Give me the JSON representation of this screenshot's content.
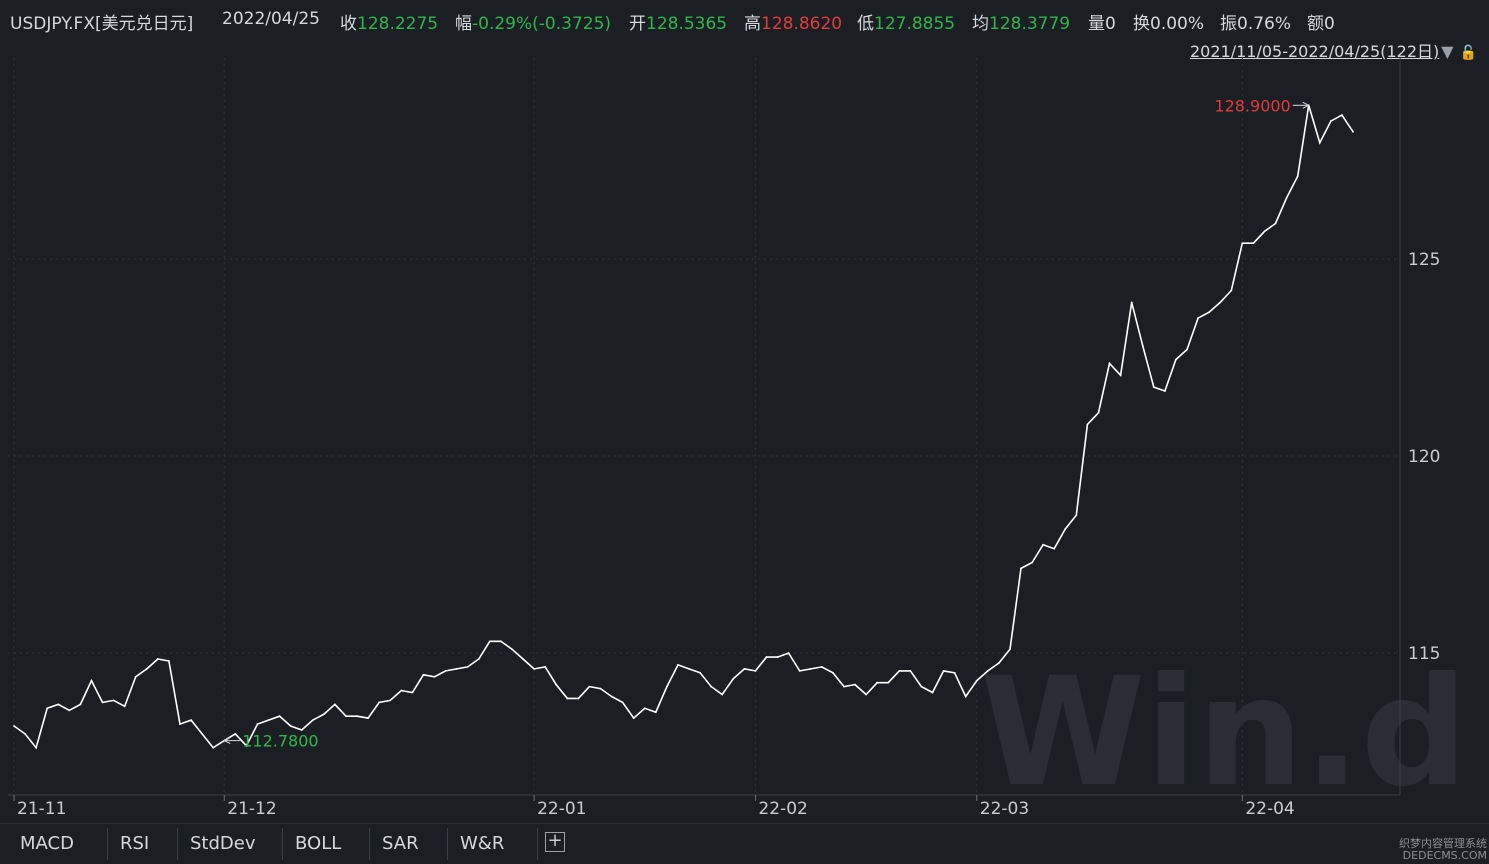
{
  "header": {
    "symbol": "USDJPY.FX[美元兑日元]",
    "date": "2022/04/25",
    "close_label": "收",
    "close_value": "128.2275",
    "change_label": "幅",
    "change_value": "-0.29%(-0.3725)",
    "open_label": "开",
    "open_value": "128.5365",
    "high_label": "高",
    "high_value": "128.8620",
    "low_label": "低",
    "low_value": "127.8855",
    "avg_label": "均",
    "avg_value": "128.3779",
    "volume_label": "量",
    "volume_value": "0",
    "turnover_label": "换",
    "turnover_value": "0.00%",
    "amplitude_label": "振",
    "amplitude_value": "0.76%",
    "amount_label": "额",
    "amount_value": "0"
  },
  "range_selector": {
    "label": "2021/11/05-2022/04/25(122日)",
    "dropdown_icon": "triangle-down-icon",
    "lock_icon": "lock-icon"
  },
  "indicator_tabs": [
    "MACD",
    "RSI",
    "StdDev",
    "BOLL",
    "SAR",
    "W&R"
  ],
  "add_tab_icon": "plus-icon",
  "watermark": {
    "logo": "Win.d",
    "site": "织梦内容管理系统",
    "site_url": "DEDECMS.COM"
  },
  "colors": {
    "background": "#1b1f24",
    "line": "#ffffff",
    "up": "#e23b3b",
    "down": "#2fb64a",
    "grid": "#3a3f47"
  },
  "chart_data": {
    "type": "line",
    "title": "",
    "xlabel": "",
    "ylabel": "",
    "x_tick_labels": [
      "21-11",
      "21-12",
      "22-01",
      "22-02",
      "22-03",
      "22-04"
    ],
    "y_ticks": [
      115,
      120,
      125
    ],
    "ylim": [
      111.4,
      130.1
    ],
    "grid": true,
    "series": [
      {
        "values": [
          113.15,
          112.95,
          112.6,
          113.6,
          113.7,
          113.55,
          113.7,
          114.3,
          113.75,
          113.8,
          113.65,
          114.4,
          114.6,
          114.85,
          114.8,
          113.2,
          113.3,
          112.95,
          112.6,
          112.78,
          112.95,
          112.65,
          113.2,
          113.3,
          113.4,
          113.15,
          113.05,
          113.3,
          113.45,
          113.7,
          113.4,
          113.4,
          113.35,
          113.75,
          113.8,
          114.05,
          114.0,
          114.45,
          114.4,
          114.55,
          114.6,
          114.65,
          114.85,
          115.3,
          115.3,
          115.1,
          114.85,
          114.6,
          114.65,
          114.2,
          113.85,
          113.85,
          114.15,
          114.1,
          113.9,
          113.75,
          113.35,
          113.6,
          113.5,
          114.15,
          114.7,
          114.6,
          114.5,
          114.15,
          113.95,
          114.35,
          114.6,
          114.55,
          114.9,
          114.9,
          115.0,
          114.55,
          114.6,
          114.65,
          114.5,
          114.15,
          114.2,
          113.95,
          114.25,
          114.25,
          114.55,
          114.55,
          114.15,
          114.0,
          114.55,
          114.5,
          113.9,
          114.3,
          114.55,
          114.75,
          115.1,
          117.15,
          117.3,
          117.75,
          117.65,
          118.15,
          118.5,
          120.8,
          121.1,
          122.35,
          122.05,
          123.9,
          122.8,
          121.75,
          121.65,
          122.45,
          122.7,
          123.5,
          123.65,
          123.9,
          124.2,
          125.4,
          125.4,
          125.7,
          125.9,
          126.55,
          127.1,
          128.9,
          127.95,
          128.5,
          128.65,
          128.23
        ]
      }
    ],
    "annotations": [
      {
        "label": "128.9000",
        "value": 128.9,
        "color": "#e23b3b"
      },
      {
        "label": "112.7800",
        "value": 112.78,
        "color": "#2fb64a"
      }
    ]
  }
}
